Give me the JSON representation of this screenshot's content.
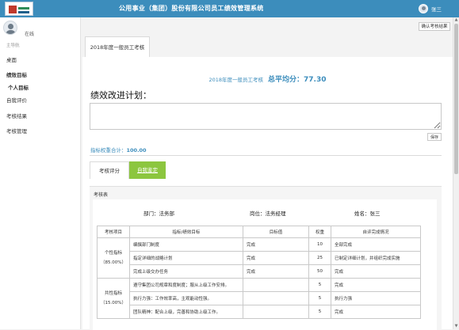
{
  "header": {
    "title": "公用事业（集团）股份有限公司员工绩效管理系统",
    "user_name": "张三"
  },
  "sidebar": {
    "status": "在线",
    "nav_head": "主导航",
    "items": [
      {
        "label": "桌面"
      },
      {
        "label": "绩效目标"
      },
      {
        "label": "个人目标"
      },
      {
        "label": "自我评价"
      },
      {
        "label": "考核结果"
      },
      {
        "label": "考核管理"
      }
    ]
  },
  "toolbar": {
    "confirm_label": "确认考核结果"
  },
  "main_tab": {
    "label": "2018年度一般员工考核"
  },
  "summary": {
    "period": "2018年度一般员工考核",
    "avg_label": "总平均分：",
    "avg_value": "77.30"
  },
  "plan": {
    "title": "绩效改进计划：",
    "value": "",
    "save_label": "保存"
  },
  "weight": {
    "label": "指标权重合计：",
    "value": "100.00"
  },
  "sub_tabs": [
    {
      "label": "考核评分"
    },
    {
      "label": "自我鉴定"
    }
  ],
  "eval": {
    "title": "考核表",
    "dept": "部门：法务部",
    "post": "岗位：法务经理",
    "name": "姓名：张三",
    "columns": [
      "考核项目",
      "指标/绩效目标",
      "目标值",
      "权重",
      "自评完成情况"
    ],
    "groups": [
      {
        "cat": "个性指标",
        "pct": "（85.00%）"
      },
      {
        "cat": "共性指标",
        "pct": "（15.00%）"
      }
    ],
    "rows": [
      {
        "target": "编撰部门制度",
        "value": "完成",
        "weight": "10",
        "self": "全部完成"
      },
      {
        "target": "指定详细的战略计划",
        "value": "完成",
        "weight": "25",
        "self": "已制定详细计划，并组织完成实施"
      },
      {
        "target": "完成上级交办任务",
        "value": "完成",
        "weight": "50",
        "self": "完成"
      },
      {
        "target": "遵守集团公司规章和度制度；服从上级工作安排。",
        "value": "",
        "weight": "5",
        "self": "完成"
      },
      {
        "target": "执行力强：工作效率高，主观能动性强。",
        "value": "",
        "weight": "5",
        "self": "执行力强"
      },
      {
        "target": "团队精神：配合上级，完善和协助上级工作。",
        "value": "",
        "weight": "5",
        "self": "完成"
      }
    ]
  }
}
